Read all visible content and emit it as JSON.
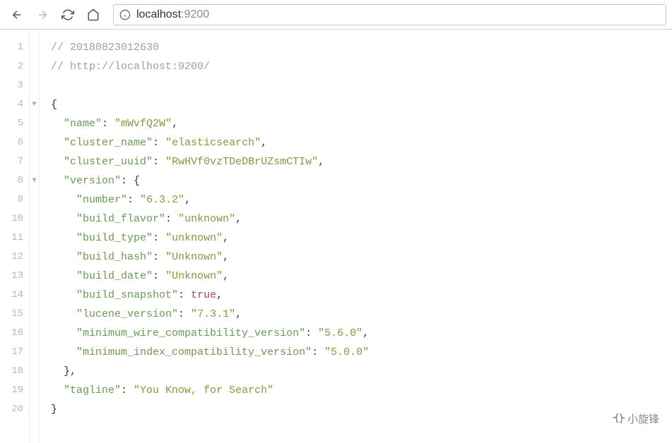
{
  "url": {
    "host": "localhost",
    "port": ":9200"
  },
  "code": {
    "comment_timestamp": "// 20180823012630",
    "comment_url": "// http://localhost:9200/",
    "lines": [
      {
        "n": 1
      },
      {
        "n": 2
      },
      {
        "n": 3
      },
      {
        "n": 4,
        "fold": "▼"
      },
      {
        "n": 5
      },
      {
        "n": 6
      },
      {
        "n": 7
      },
      {
        "n": 8,
        "fold": "▼"
      },
      {
        "n": 9
      },
      {
        "n": 10
      },
      {
        "n": 11
      },
      {
        "n": 12
      },
      {
        "n": 13
      },
      {
        "n": 14
      },
      {
        "n": 15
      },
      {
        "n": 16
      },
      {
        "n": 17
      },
      {
        "n": 18
      },
      {
        "n": 19
      },
      {
        "n": 20
      }
    ],
    "json": {
      "name_key": "\"name\"",
      "name_val": "\"mWvfQ2W\"",
      "cluster_name_key": "\"cluster_name\"",
      "cluster_name_val": "\"elasticsearch\"",
      "cluster_uuid_key": "\"cluster_uuid\"",
      "cluster_uuid_val": "\"RwHVf0vzTDeDBrUZsmCTIw\"",
      "version_key": "\"version\"",
      "number_key": "\"number\"",
      "number_val": "\"6.3.2\"",
      "build_flavor_key": "\"build_flavor\"",
      "build_flavor_val": "\"unknown\"",
      "build_type_key": "\"build_type\"",
      "build_type_val": "\"unknown\"",
      "build_hash_key": "\"build_hash\"",
      "build_hash_val": "\"Unknown\"",
      "build_date_key": "\"build_date\"",
      "build_date_val": "\"Unknown\"",
      "build_snapshot_key": "\"build_snapshot\"",
      "build_snapshot_val": "true",
      "lucene_version_key": "\"lucene_version\"",
      "lucene_version_val": "\"7.3.1\"",
      "min_wire_key": "\"minimum_wire_compatibility_version\"",
      "min_wire_val": "\"5.6.0\"",
      "min_index_key": "\"minimum_index_compatibility_version\"",
      "min_index_val": "\"5.0.0\"",
      "tagline_key": "\"tagline\"",
      "tagline_val": "\"You Know, for Search\""
    }
  },
  "watermark": "小旋锋"
}
